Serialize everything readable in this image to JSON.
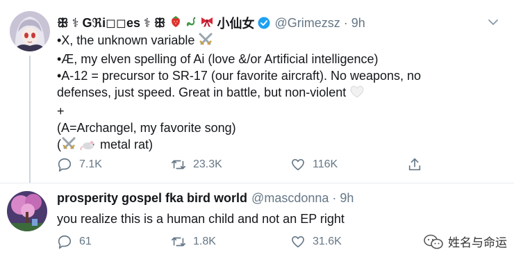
{
  "tweet1": {
    "display_name_prefix": "ꕥ ⚕ Gℜi◻◻es ⚕ ꕥ",
    "display_name_suffix": "小仙女",
    "handle": "@Grimezsz",
    "dot": "·",
    "time": "9h",
    "lines": [
      "•X, the unknown variable",
      "•Æ, my elven spelling of Ai (love &/or Artificial intelligence)",
      "•A-12 = precursor to SR-17 (our favorite aircraft).  No weapons, no",
      "defenses, just speed.  Great in battle, but non-violent",
      "+",
      "(A=Archangel, my favorite song)",
      "metal rat)"
    ],
    "line7_open": "(",
    "replies": "7.1K",
    "retweets": "23.3K",
    "likes": "116K"
  },
  "tweet2": {
    "display_name": "prosperity gospel fka bird world",
    "handle": "@mascdonna",
    "dot": "·",
    "time": "9h",
    "text": "you realize this is a human child and not an EP right",
    "replies": "61",
    "retweets": "1.8K",
    "likes": "31.6K"
  },
  "watermark": "姓名与命运",
  "colors": {
    "text": "#14171a",
    "secondary": "#657786",
    "verified": "#1da1f2",
    "divider": "#e6ecf0"
  },
  "icons": [
    "reply-icon",
    "retweet-icon",
    "like-icon",
    "share-icon",
    "verified-icon",
    "chevron-down-icon",
    "swords-icon",
    "white-heart-icon",
    "rat-icon",
    "strawberry-icon",
    "dragon-icon",
    "ribbon-icon",
    "wechat-icon"
  ]
}
